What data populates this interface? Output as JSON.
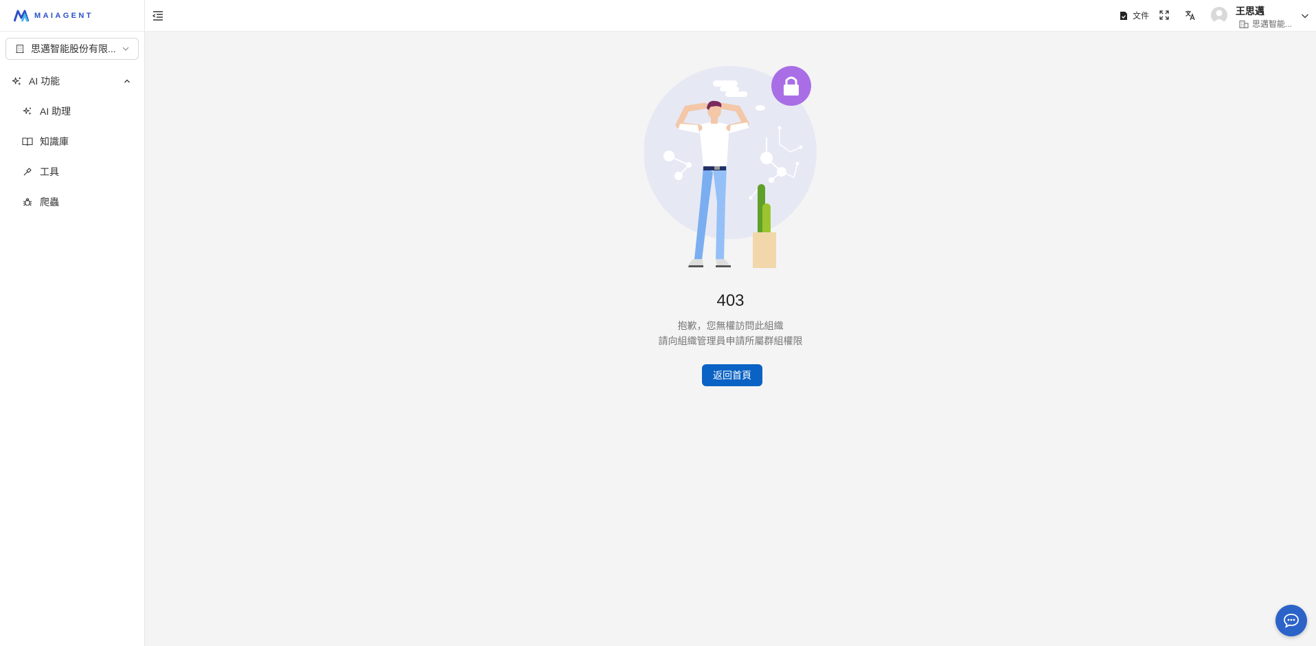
{
  "brand": {
    "logo_text": "MAIAGENT",
    "accent": "#2a4fc9"
  },
  "sidebar": {
    "org_select": {
      "value": "思邁智能股份有限...",
      "icon": "building-icon"
    },
    "group": {
      "label": "AI 功能",
      "icon": "sparkles-icon",
      "expanded": true
    },
    "items": [
      {
        "label": "AI 助理",
        "icon": "sparkles-icon"
      },
      {
        "label": "知識庫",
        "icon": "book-icon"
      },
      {
        "label": "工具",
        "icon": "tool-icon"
      },
      {
        "label": "爬蟲",
        "icon": "bug-icon"
      }
    ]
  },
  "header": {
    "docs_label": "文件",
    "user": {
      "name": "王思邁",
      "org": "思邁智能..."
    }
  },
  "error": {
    "code": "403",
    "message_line1": "抱歉，您無權訪問此組織",
    "message_line2": "請向組織管理員申請所屬群組權限",
    "button_label": "返回首頁"
  },
  "colors": {
    "primary_button": "#0a62c4",
    "chat_fab": "#2c63c8",
    "lock_badge": "#a96ee6"
  }
}
